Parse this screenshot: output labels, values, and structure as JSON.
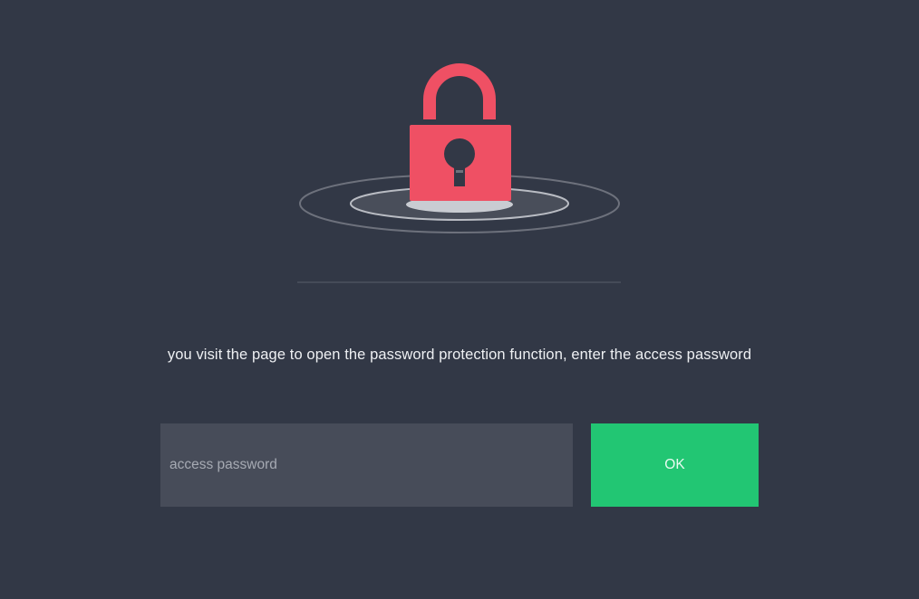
{
  "lock_icon": "lock-icon",
  "message": {
    "text": "you visit the page to open the password protection function, enter the access password"
  },
  "password_field": {
    "placeholder": "access password",
    "value": ""
  },
  "ok_button": {
    "label": "OK"
  },
  "colors": {
    "background": "#323846",
    "lock": "#ef5064",
    "input_background": "#474c59",
    "button": "#22c673"
  }
}
